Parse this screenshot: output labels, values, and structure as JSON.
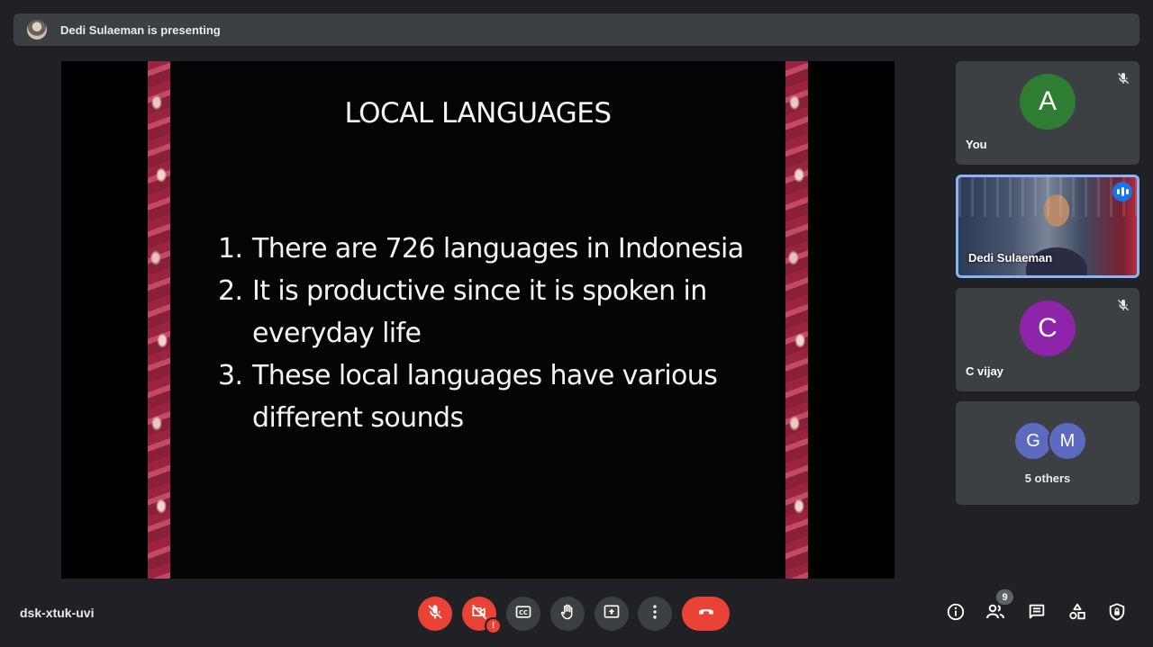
{
  "banner": {
    "presenter_text": "Dedi Sulaeman is presenting"
  },
  "slide": {
    "title": "LOCAL LANGUAGES",
    "items": [
      {
        "num": "1.",
        "text": "There are 726 languages in Indonesia"
      },
      {
        "num": "2.",
        "text": "It is productive since it is spoken in everyday life"
      },
      {
        "num": "3.",
        "text": "These local languages have various different sounds"
      }
    ]
  },
  "participants": {
    "you": {
      "initial": "A",
      "name": "You",
      "color": "#2e7d32",
      "muted": true
    },
    "presenter": {
      "name": "Dedi Sulaeman",
      "speaking": true
    },
    "c_vijay": {
      "initial": "C",
      "name": "C vijay",
      "color": "#8e24aa",
      "muted": true
    },
    "others": {
      "avatars": [
        {
          "initial": "G",
          "color": "#5c6bc0"
        },
        {
          "initial": "M",
          "color": "#5c6bc0"
        }
      ],
      "label": "5 others"
    }
  },
  "bottom_bar": {
    "meeting_code": "dsk-xtuk-uvi",
    "camera_alert": "!",
    "participant_count": "9"
  },
  "icons": {
    "mic": "mic-off-icon",
    "camera": "videocam-off-icon",
    "captions": "closed-captions-icon",
    "hand": "raise-hand-icon",
    "present": "present-screen-icon",
    "more": "more-options-icon",
    "end": "call-end-icon",
    "info": "info-icon",
    "people": "people-icon",
    "chat": "chat-icon",
    "activities": "activities-icon",
    "host": "host-controls-icon"
  }
}
